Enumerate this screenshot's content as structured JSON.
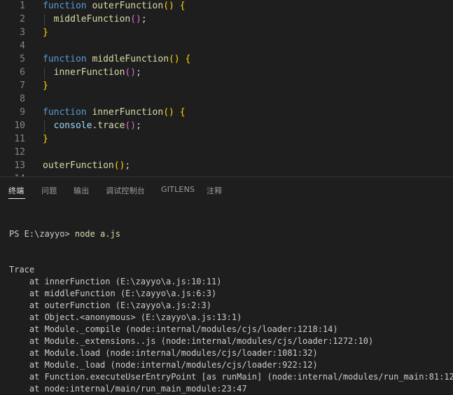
{
  "editor": {
    "lines": [
      {
        "n": "1",
        "tokens": [
          {
            "t": "function",
            "c": "kw"
          },
          {
            "t": " ",
            "c": "pl"
          },
          {
            "t": "outerFunction",
            "c": "fn"
          },
          {
            "t": "()",
            "c": "b1"
          },
          {
            "t": " ",
            "c": "pl"
          },
          {
            "t": "{",
            "c": "b1"
          }
        ]
      },
      {
        "n": "2",
        "tokens": [
          {
            "t": "  ",
            "c": "pl"
          },
          {
            "t": "middleFunction",
            "c": "fn"
          },
          {
            "t": "()",
            "c": "b2"
          },
          {
            "t": ";",
            "c": "pl"
          }
        ]
      },
      {
        "n": "3",
        "tokens": [
          {
            "t": "}",
            "c": "b1"
          }
        ]
      },
      {
        "n": "4",
        "tokens": []
      },
      {
        "n": "5",
        "tokens": [
          {
            "t": "function",
            "c": "kw"
          },
          {
            "t": " ",
            "c": "pl"
          },
          {
            "t": "middleFunction",
            "c": "fn"
          },
          {
            "t": "()",
            "c": "b1"
          },
          {
            "t": " ",
            "c": "pl"
          },
          {
            "t": "{",
            "c": "b1"
          }
        ]
      },
      {
        "n": "6",
        "tokens": [
          {
            "t": "  ",
            "c": "pl"
          },
          {
            "t": "innerFunction",
            "c": "fn"
          },
          {
            "t": "()",
            "c": "b2"
          },
          {
            "t": ";",
            "c": "pl"
          }
        ]
      },
      {
        "n": "7",
        "tokens": [
          {
            "t": "}",
            "c": "b1"
          }
        ]
      },
      {
        "n": "8",
        "tokens": []
      },
      {
        "n": "9",
        "tokens": [
          {
            "t": "function",
            "c": "kw"
          },
          {
            "t": " ",
            "c": "pl"
          },
          {
            "t": "innerFunction",
            "c": "fn"
          },
          {
            "t": "()",
            "c": "b1"
          },
          {
            "t": " ",
            "c": "pl"
          },
          {
            "t": "{",
            "c": "b1"
          }
        ]
      },
      {
        "n": "10",
        "tokens": [
          {
            "t": "  ",
            "c": "pl"
          },
          {
            "t": "console",
            "c": "var"
          },
          {
            "t": ".",
            "c": "pl"
          },
          {
            "t": "trace",
            "c": "fn"
          },
          {
            "t": "()",
            "c": "b2"
          },
          {
            "t": ";",
            "c": "pl"
          }
        ]
      },
      {
        "n": "11",
        "tokens": [
          {
            "t": "}",
            "c": "b1"
          }
        ]
      },
      {
        "n": "12",
        "tokens": []
      },
      {
        "n": "13",
        "tokens": [
          {
            "t": "outerFunction",
            "c": "fn"
          },
          {
            "t": "()",
            "c": "b1"
          },
          {
            "t": ";",
            "c": "pl"
          }
        ]
      },
      {
        "n": "14",
        "tokens": []
      }
    ]
  },
  "panel": {
    "tabs": [
      "终端",
      "问题",
      "输出",
      "调试控制台",
      "GITLENS",
      "注释"
    ],
    "terminal": {
      "prompt": "PS E:\\zayyo> ",
      "command": "node a.js",
      "lines": [
        "Trace",
        "    at innerFunction (E:\\zayyo\\a.js:10:11)",
        "    at middleFunction (E:\\zayyo\\a.js:6:3)",
        "    at outerFunction (E:\\zayyo\\a.js:2:3)",
        "    at Object.<anonymous> (E:\\zayyo\\a.js:13:1)",
        "    at Module._compile (node:internal/modules/cjs/loader:1218:14)",
        "    at Module._extensions..js (node:internal/modules/cjs/loader:1272:10)",
        "    at Module.load (node:internal/modules/cjs/loader:1081:32)",
        "    at Module._load (node:internal/modules/cjs/loader:922:12)",
        "    at Function.executeUserEntryPoint [as runMain] (node:internal/modules/run_main:81:12)",
        "    at node:internal/main/run_main_module:23:47"
      ]
    }
  }
}
